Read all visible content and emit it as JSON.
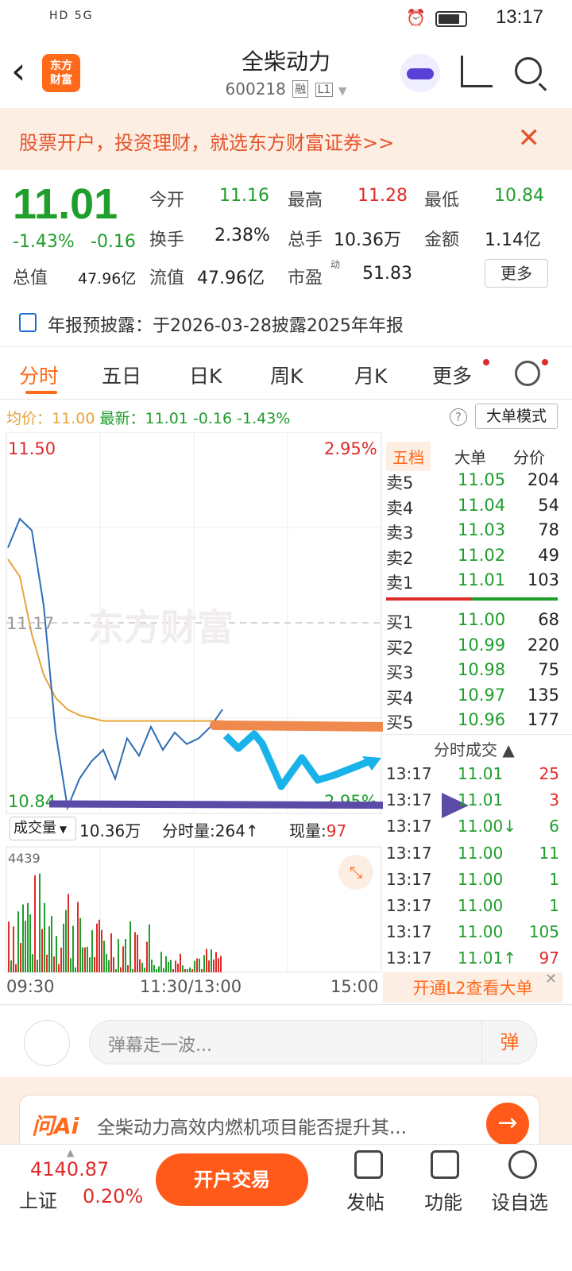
{
  "status": {
    "left": "HD 5G",
    "time": "13:17"
  },
  "header": {
    "title": "全柴动力",
    "code": "600218",
    "tag1": "融",
    "tag2": "L1",
    "logo": "东方\n财富"
  },
  "promo": {
    "text": "股票开户，投资理财，就选东方财富证券>>"
  },
  "quote": {
    "price": "11.01",
    "pct": "-1.43%",
    "chg": "-0.16",
    "open_label": "今开",
    "open": "11.16",
    "high_label": "最高",
    "high": "11.28",
    "low_label": "最低",
    "low": "10.84",
    "turnover_label": "换手",
    "turnover": "2.38%",
    "volume_label": "总手",
    "volume": "10.36万",
    "amount_label": "金额",
    "amount": "1.14亿",
    "mktcap_label": "总值",
    "mktcap": "47.96亿",
    "float_label": "流值",
    "float": "47.96亿",
    "pe_label": "市盈",
    "pe_sup": "动",
    "pe": "51.83",
    "more": "更多"
  },
  "notice": "年报预披露：于2026-03-28披露2025年年报",
  "tabs": [
    "分时",
    "五日",
    "日K",
    "周K",
    "月K",
    "更多"
  ],
  "avg": {
    "avg_label": "均价：",
    "avg": "11.00",
    "new_label": "最新：",
    "new": "11.01",
    "chg": "-0.16",
    "pct": "-1.43%"
  },
  "mode_button": "大单模式",
  "chart": {
    "top_price": "11.50",
    "top_pct": "2.95%",
    "mid_price": "11.17",
    "bottom_price": "10.84",
    "bottom_pct": "2.95%",
    "watermark": "东方财富"
  },
  "orderbook": {
    "tabs": [
      "五档",
      "大单",
      "分价"
    ],
    "asks": [
      {
        "label": "卖5",
        "price": "11.05",
        "vol": "204"
      },
      {
        "label": "卖4",
        "price": "11.04",
        "vol": "54"
      },
      {
        "label": "卖3",
        "price": "11.03",
        "vol": "78"
      },
      {
        "label": "卖2",
        "price": "11.02",
        "vol": "49"
      },
      {
        "label": "卖1",
        "price": "11.01",
        "vol": "103"
      }
    ],
    "bids": [
      {
        "label": "买1",
        "price": "11.00",
        "vol": "68"
      },
      {
        "label": "买2",
        "price": "10.99",
        "vol": "220"
      },
      {
        "label": "买3",
        "price": "10.98",
        "vol": "75"
      },
      {
        "label": "买4",
        "price": "10.97",
        "vol": "135"
      },
      {
        "label": "买5",
        "price": "10.96",
        "vol": "177"
      }
    ],
    "trades_title": "分时成交",
    "trades": [
      {
        "time": "13:17",
        "price": "11.01",
        "vol": "25",
        "color": "red"
      },
      {
        "time": "13:17",
        "price": "11.01",
        "vol": "3",
        "color": "red"
      },
      {
        "time": "13:17",
        "price": "11.00↓",
        "vol": "6",
        "color": "green"
      },
      {
        "time": "13:17",
        "price": "11.00",
        "vol": "11",
        "color": "green"
      },
      {
        "time": "13:17",
        "price": "11.00",
        "vol": "1",
        "color": "green"
      },
      {
        "time": "13:17",
        "price": "11.00",
        "vol": "1",
        "color": "green"
      },
      {
        "time": "13:17",
        "price": "11.00",
        "vol": "105",
        "color": "green"
      },
      {
        "time": "13:17",
        "price": "11.01↑",
        "vol": "97",
        "color": "red"
      }
    ],
    "l2": "开通L2查看大单"
  },
  "volume": {
    "dropdown": "成交量",
    "total": "10.36万",
    "minute_label": "分时量:",
    "minute": "264↑",
    "now_label": "现量:",
    "now": "97",
    "max": "4439"
  },
  "timeaxis": [
    "09:30",
    "11:30/13:00",
    "15:00"
  ],
  "comment": {
    "placeholder": "弹幕走一波...",
    "danmu": "弹"
  },
  "ai": {
    "logo": "问Ai",
    "text": "全柴动力高效内燃机项目能否提升其...",
    "go": "→"
  },
  "bottom": {
    "index_value": "4140.87",
    "index_name": "上证",
    "index_pct": "0.20%",
    "trade": "开户交易",
    "nav": [
      "发帖",
      "功能",
      "设自选"
    ]
  },
  "colors": {
    "accent": "#ff6a1a",
    "up": "#e02a2a",
    "down": "#1f9e2c",
    "avg_line": "#e8a43a",
    "price_line": "#2e6db5"
  },
  "chart_data": {
    "type": "line",
    "series": [
      {
        "values": [
          11.3,
          11.35,
          11.33,
          11.2,
          10.98,
          10.85,
          10.9,
          10.93,
          10.95,
          10.9,
          10.97,
          10.94,
          10.99,
          10.95,
          10.98,
          10.96,
          10.97,
          10.99,
          11.02
        ]
      },
      {
        "values": [
          11.28,
          11.25,
          11.15,
          11.08,
          11.04,
          11.02,
          11.01,
          11.005,
          11.0,
          11.0,
          11.0,
          11.0,
          11.0,
          11.0,
          11.0,
          11.0,
          11.0,
          11.0,
          11.0
        ]
      }
    ],
    "ylim": [
      10.84,
      11.5
    ]
  }
}
